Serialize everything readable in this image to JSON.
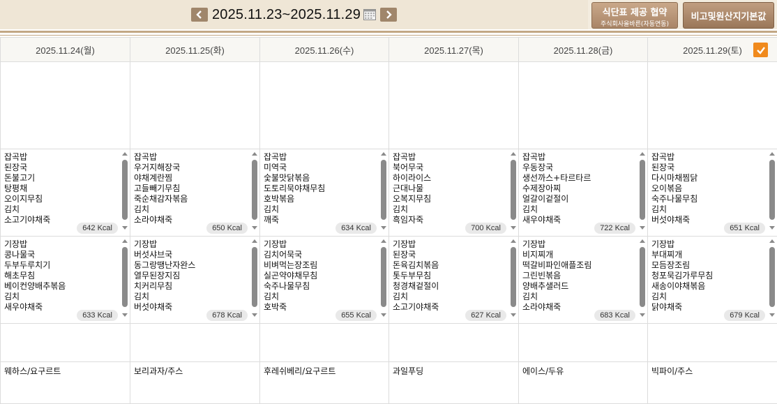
{
  "week_nav": {
    "range": "2025.11.23~2025.11.29"
  },
  "buttons": {
    "meal_main": "식단표 제공 협약",
    "meal_sub": "주식회사올바른(자동연동)",
    "origin": "비고및원산지기본값"
  },
  "days": [
    {
      "date": "2025.11.24(월)",
      "lunch": [
        "잡곡밥",
        "된장국",
        "돈불고기",
        "탕평채",
        "오이지무침",
        "김치",
        "소고기야채죽"
      ],
      "lunch_kcal": "642 Kcal",
      "dinner": [
        "기장밥",
        "콩나물국",
        "두부두루치기",
        "해초무침",
        "베이컨양배추볶음",
        "김치",
        "새우야채죽"
      ],
      "dinner_kcal": "633 Kcal",
      "snack": "웨하스/요구르트"
    },
    {
      "date": "2025.11.25(화)",
      "lunch": [
        "잡곡밥",
        "우거지해장국",
        "야채계란찜",
        "고들빼기무침",
        "죽순채감자볶음",
        "김치",
        "소라야채죽"
      ],
      "lunch_kcal": "650 Kcal",
      "dinner": [
        "기장밥",
        "버섯샤브국",
        "동그랑땡난자완스",
        "열무된장지짐",
        "치커리무침",
        "김치",
        "버섯야채죽"
      ],
      "dinner_kcal": "678 Kcal",
      "snack": "보리과자/주스"
    },
    {
      "date": "2025.11.26(수)",
      "lunch": [
        "잡곡밥",
        "미역국",
        "숯불맛닭볶음",
        "도토리묵야채무침",
        "호박볶음",
        "김치",
        "깨죽"
      ],
      "lunch_kcal": "634 Kcal",
      "dinner": [
        "기장밥",
        "김치어묵국",
        "비벼먹는장조림",
        "실곤약야채무침",
        "숙주나물무침",
        "김치",
        "호박죽"
      ],
      "dinner_kcal": "655 Kcal",
      "snack": "후레쉬베리/요구르트"
    },
    {
      "date": "2025.11.27(목)",
      "lunch": [
        "잡곡밥",
        "북어무국",
        "하이라이스",
        "근대나물",
        "오복지무침",
        "김치",
        "흑임자죽"
      ],
      "lunch_kcal": "700 Kcal",
      "dinner": [
        "기장밥",
        "된장국",
        "돈육김치볶음",
        "톳두부무침",
        "청경채겉절이",
        "김치",
        "소고기야채죽"
      ],
      "dinner_kcal": "627 Kcal",
      "snack": "과일푸딩"
    },
    {
      "date": "2025.11.28(금)",
      "lunch": [
        "잡곡밥",
        "우동장국",
        "생선까스+타르타르",
        "수제장아찌",
        "얼갈이겉절이",
        "김치",
        "새우야채죽"
      ],
      "lunch_kcal": "722 Kcal",
      "dinner": [
        "기장밥",
        "비지찌개",
        "떡갈비파인애플조림",
        "그린빈볶음",
        "양배추샐러드",
        "김치",
        "소라야채죽"
      ],
      "dinner_kcal": "683 Kcal",
      "snack": "에이스/두유"
    },
    {
      "date": "2025.11.29(토)",
      "lunch": [
        "잡곡밥",
        "된장국",
        "다시마채찜닭",
        "오이볶음",
        "숙주나물무침",
        "김치",
        "버섯야채죽"
      ],
      "lunch_kcal": "651 Kcal",
      "dinner": [
        "기장밥",
        "부대찌개",
        "모듬장조림",
        "청포묵김가루무침",
        "새송이야채볶음",
        "김치",
        "닭야채죽"
      ],
      "dinner_kcal": "679 Kcal",
      "snack": "빅파이/주스"
    }
  ]
}
